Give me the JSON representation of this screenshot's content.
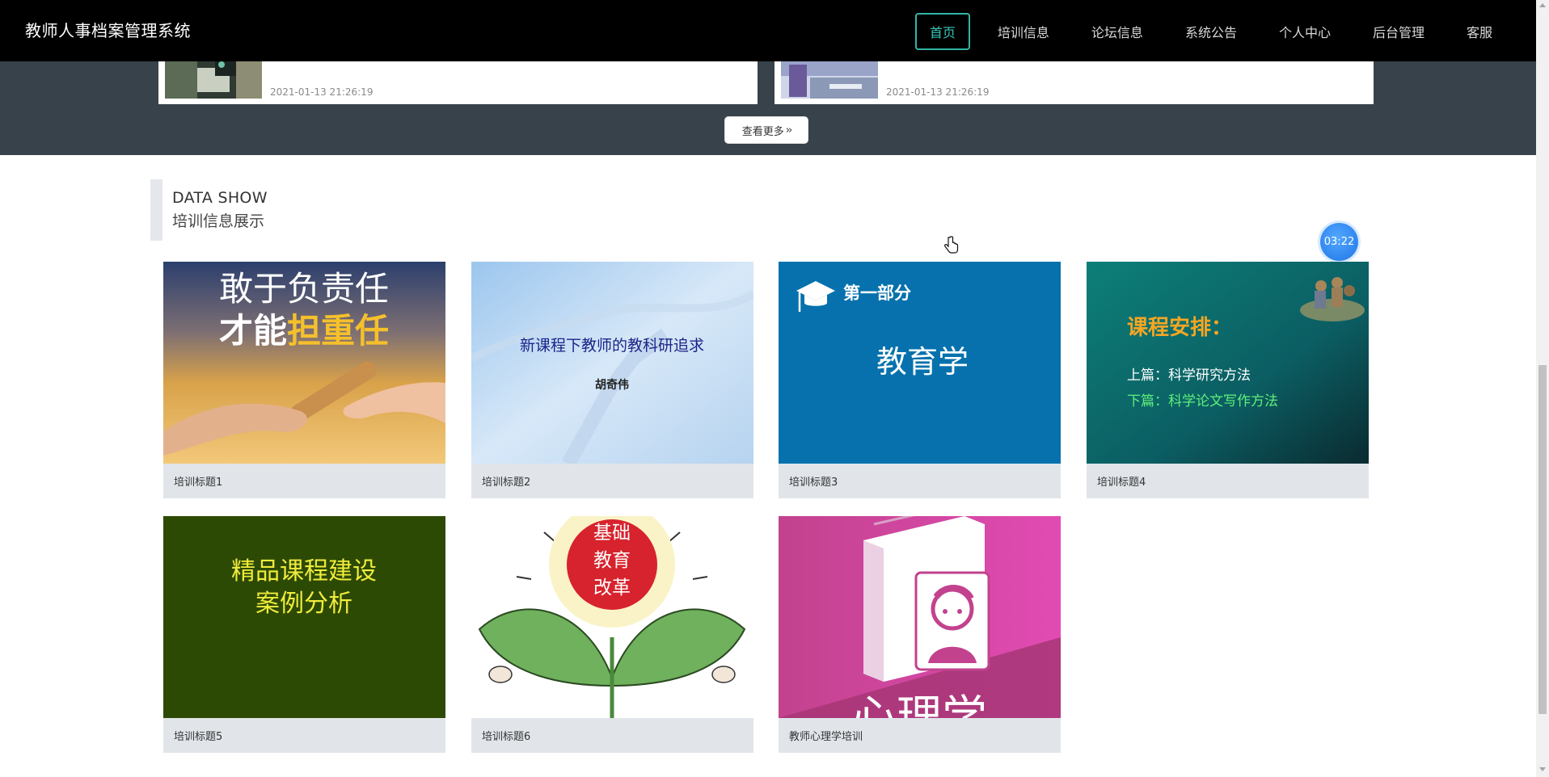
{
  "app": {
    "title": "教师人事档案管理系统"
  },
  "nav": {
    "items": [
      {
        "label": "首页",
        "active": true
      },
      {
        "label": "培训信息"
      },
      {
        "label": "论坛信息"
      },
      {
        "label": "系统公告"
      },
      {
        "label": "个人中心"
      },
      {
        "label": "后台管理"
      },
      {
        "label": "客服"
      }
    ]
  },
  "news": {
    "items": [
      {
        "time": "2021-01-13 21:26:19"
      },
      {
        "time": "2021-01-13 21:26:19"
      }
    ],
    "more_label": "查看更多"
  },
  "section": {
    "en_title": "DATA SHOW",
    "cn_title": "培训信息展示"
  },
  "timer": {
    "value": "03:22"
  },
  "cards": [
    {
      "caption": "培训标题1",
      "image_text": [
        "敢于负责任",
        "才能",
        "担重任"
      ]
    },
    {
      "caption": "培训标题2",
      "image_text": [
        "新课程下教师的教科研追求",
        "胡奇伟"
      ]
    },
    {
      "caption": "培训标题3",
      "image_text": [
        "第一部分",
        "教育学"
      ]
    },
    {
      "caption": "培训标题4",
      "image_text": [
        "课程安排：",
        "上篇：科学研究方法",
        "下篇：科学论文写作方法"
      ]
    },
    {
      "caption": "培训标题5",
      "image_text": [
        "精品课程建设",
        "案例分析"
      ]
    },
    {
      "caption": "培训标题6",
      "image_text": [
        "基础",
        "教育",
        "改革"
      ]
    },
    {
      "caption": "教师心理学培训",
      "image_text": [
        "心理学"
      ]
    }
  ],
  "colors": {
    "nav_bg": "#000000",
    "accent": "#2fb5a6",
    "band_bg": "#38424a",
    "caption_bg": "#e1e5ea",
    "timer": "#2f84ee"
  },
  "icons": [
    "hand-cursor-icon",
    "double-chevron-right-icon",
    "graduation-cap-icon"
  ]
}
